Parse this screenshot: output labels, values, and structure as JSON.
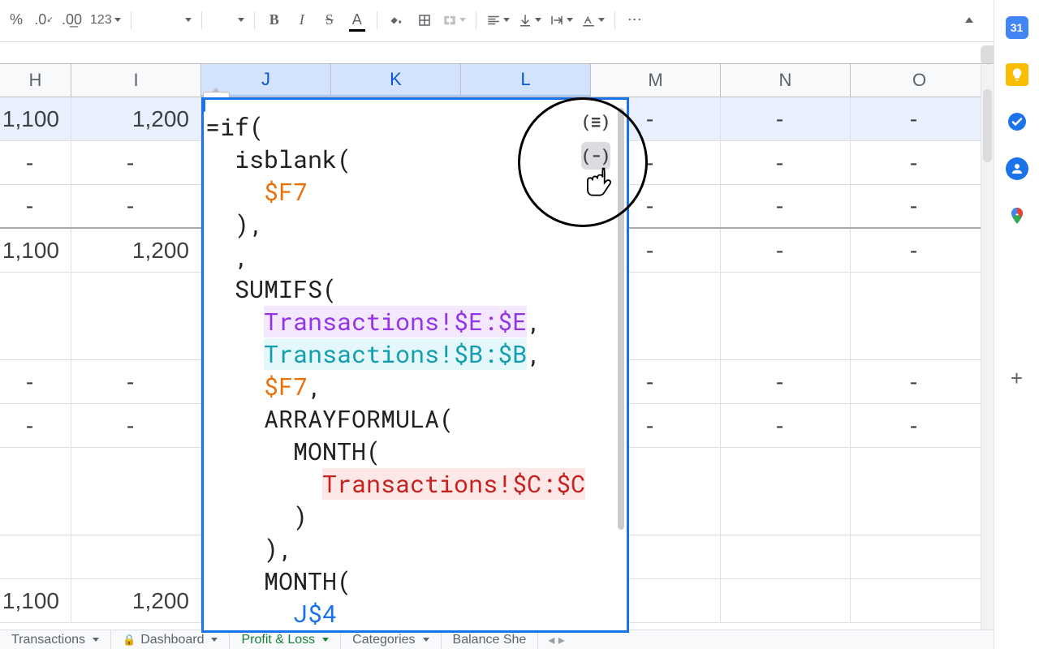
{
  "toolbar": {
    "percent": "%",
    "dec_dec": ".0̲",
    "inc_dec": ".00",
    "num_fmt": "123",
    "bold": "B",
    "italic": "I",
    "strike": "S",
    "text_color": "A",
    "more": "⋯"
  },
  "columns": [
    "H",
    "I",
    "J",
    "K",
    "L",
    "M",
    "N",
    "O"
  ],
  "cell_tag": {
    "dash": "-",
    "x": "×"
  },
  "rows": [
    {
      "highlighted": true,
      "thick": false,
      "tall": false,
      "cells": [
        "1,100",
        "1,200",
        "",
        "",
        "",
        "-",
        "-",
        "-"
      ]
    },
    {
      "highlighted": false,
      "thick": false,
      "tall": false,
      "cells": [
        "-",
        "-",
        "",
        "",
        "",
        "-",
        "-",
        "-"
      ]
    },
    {
      "highlighted": false,
      "thick": true,
      "tall": false,
      "cells": [
        "-",
        "-",
        "",
        "",
        "",
        "-",
        "-",
        "-"
      ]
    },
    {
      "highlighted": false,
      "thick": false,
      "tall": false,
      "cells": [
        "1,100",
        "1,200",
        "",
        "",
        "",
        "-",
        "-",
        "-"
      ]
    },
    {
      "highlighted": false,
      "thick": false,
      "tall": true,
      "cells": [
        "",
        "",
        "",
        "",
        "",
        "",
        "",
        ""
      ]
    },
    {
      "highlighted": false,
      "thick": false,
      "tall": false,
      "cells": [
        "-",
        "-",
        "",
        "",
        "",
        "-",
        "-",
        "-"
      ]
    },
    {
      "highlighted": false,
      "thick": false,
      "tall": false,
      "cells": [
        "-",
        "-",
        "",
        "",
        "",
        "-",
        "-",
        "-"
      ]
    },
    {
      "highlighted": false,
      "thick": false,
      "tall": true,
      "cells": [
        "",
        "",
        "",
        "",
        "",
        "",
        "",
        ""
      ]
    },
    {
      "highlighted": false,
      "thick": false,
      "tall": false,
      "cells": [
        "",
        "",
        "",
        "",
        "",
        "",
        "",
        ""
      ]
    },
    {
      "highlighted": false,
      "thick": false,
      "tall": false,
      "cells": [
        "1,100",
        "1,200",
        "",
        "",
        "",
        "",
        "",
        ""
      ]
    }
  ],
  "formula": {
    "help": "?",
    "l1": "=if(",
    "l2": "  isblank(",
    "l3_ref": "$F7",
    "l4": "  ),",
    "l5": "  ,",
    "l6": "  SUMIFS(",
    "l7_ref": "Transactions!$E:$E",
    "l8_ref": "Transactions!$B:$B",
    "l9_ref": "$F7",
    "l10": "    ARRAYFORMULA(",
    "l11": "      MONTH(",
    "l12_ref": "Transactions!$C:$C",
    "l13": "      )",
    "l14": "    ),",
    "l15": "    MONTH(",
    "l16_ref": "J$4",
    "icon_wrap": "(≡)",
    "icon_collapse": "(-)"
  },
  "tabs": {
    "t1": "Transactions",
    "t2": "Dashboard",
    "t3": "Profit & Loss",
    "t4": "Categories",
    "t5": "Balance She"
  },
  "side": {
    "cal": "31",
    "contacts": "👤"
  }
}
